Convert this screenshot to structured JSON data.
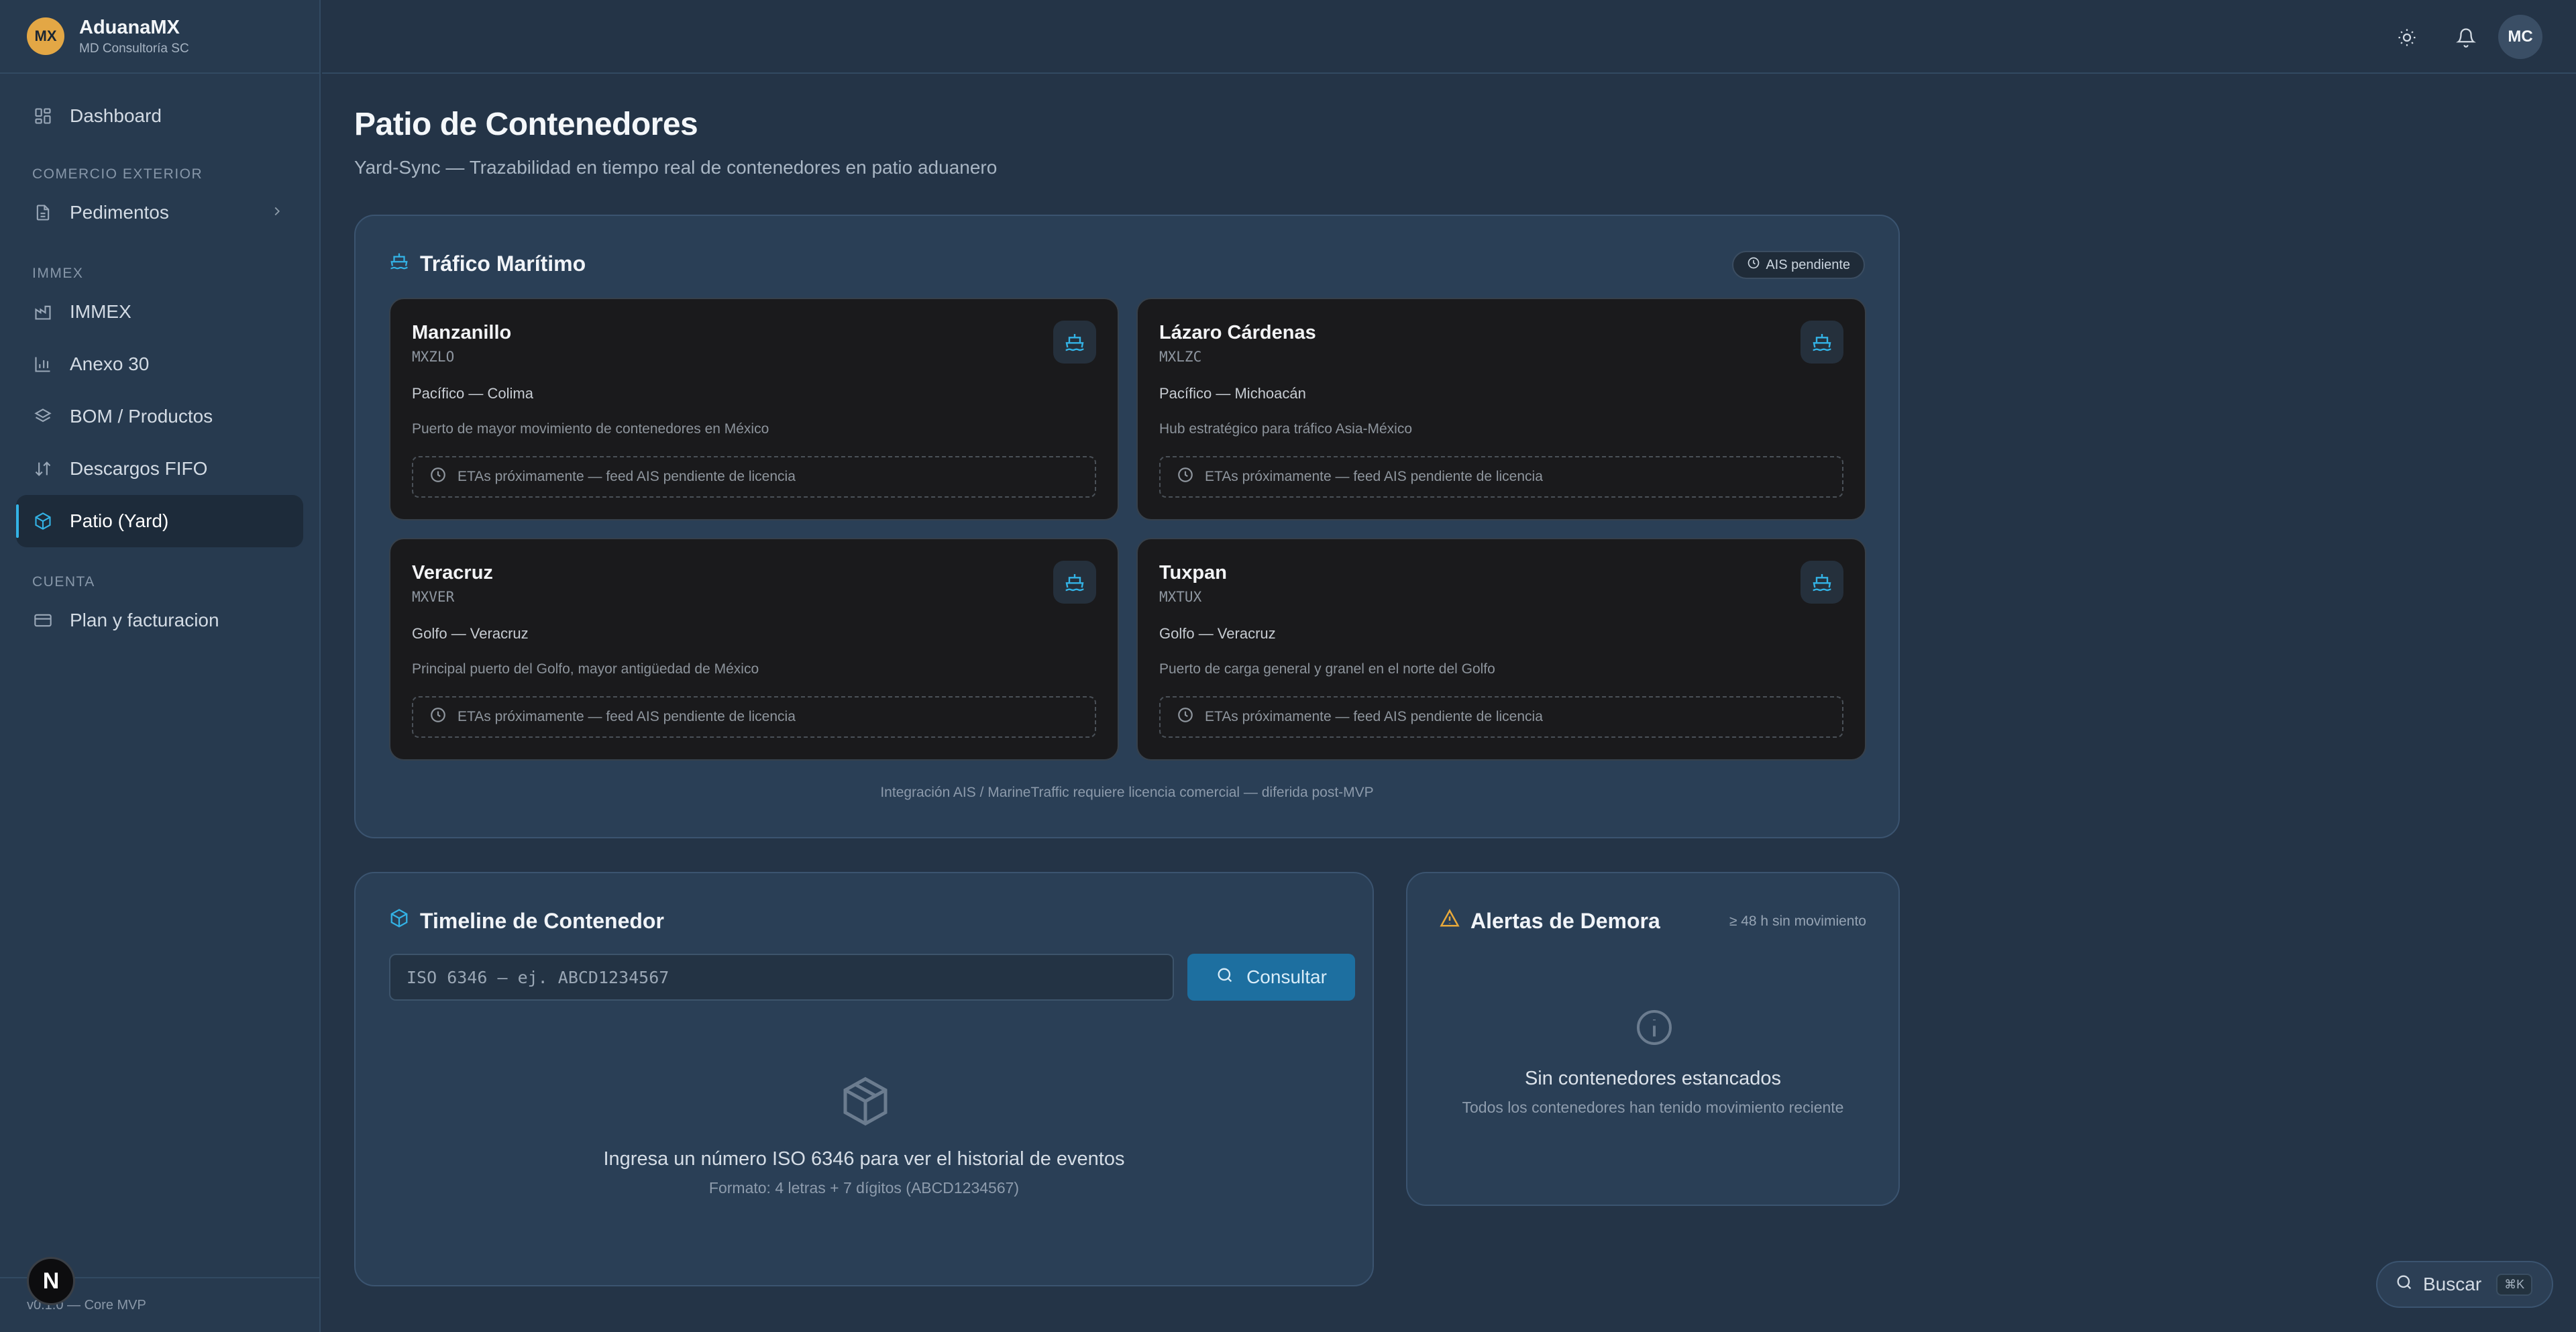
{
  "brand": {
    "logo": "MX",
    "name": "AduanaMX",
    "company": "MD Consultoría SC"
  },
  "sidebar": {
    "dashboard": "Dashboard",
    "section_comercio": "COMERCIO EXTERIOR",
    "pedimentos": "Pedimentos",
    "section_immex": "IMMEX",
    "immex": "IMMEX",
    "anexo30": "Anexo 30",
    "bom": "BOM / Productos",
    "fifo": "Descargos FIFO",
    "patio": "Patio (Yard)",
    "section_cuenta": "CUENTA",
    "plan": "Plan y facturacion",
    "version": "v0.1.0 — Core MVP",
    "n_badge": "N"
  },
  "header": {
    "avatar": "MC",
    "icons": [
      "sun-icon",
      "bell-icon"
    ]
  },
  "page": {
    "title": "Patio de Contenedores",
    "subtitle": "Yard-Sync — Trazabilidad en tiempo real de contenedores en patio aduanero"
  },
  "maritime": {
    "title": "Tráfico Marítimo",
    "badge": "AIS pendiente",
    "ports": [
      {
        "name": "Manzanillo",
        "code": "MXZLO",
        "region": "Pacífico — Colima",
        "desc": "Puerto de mayor movimiento de contenedores en México",
        "eta": "ETAs próximamente — feed AIS pendiente de licencia"
      },
      {
        "name": "Lázaro Cárdenas",
        "code": "MXLZC",
        "region": "Pacífico — Michoacán",
        "desc": "Hub estratégico para tráfico Asia-México",
        "eta": "ETAs próximamente — feed AIS pendiente de licencia"
      },
      {
        "name": "Veracruz",
        "code": "MXVER",
        "region": "Golfo — Veracruz",
        "desc": "Principal puerto del Golfo, mayor antigüedad de México",
        "eta": "ETAs próximamente — feed AIS pendiente de licencia"
      },
      {
        "name": "Tuxpan",
        "code": "MXTUX",
        "region": "Golfo — Veracruz",
        "desc": "Puerto de carga general y granel en el norte del Golfo",
        "eta": "ETAs próximamente — feed AIS pendiente de licencia"
      }
    ],
    "note": "Integración AIS / MarineTraffic requiere licencia comercial — diferida post-MVP"
  },
  "timeline": {
    "title": "Timeline de Contenedor",
    "placeholder": "ISO 6346 — ej. ABCD1234567",
    "button": "Consultar",
    "empty_title": "Ingresa un número ISO 6346 para ver el historial de eventos",
    "empty_sub": "Formato: 4 letras + 7 dígitos (ABCD1234567)"
  },
  "alerts": {
    "title": "Alertas de Demora",
    "threshold": "≥ 48 h sin movimiento",
    "empty_title": "Sin contenedores estancados",
    "empty_sub": "Todos los contenedores han tenido movimiento reciente"
  },
  "search": {
    "label": "Buscar",
    "shortcut": "⌘K"
  },
  "colors": {
    "accent": "#33b3e6",
    "warning": "#e8a93a",
    "brand": "#e3a745"
  }
}
